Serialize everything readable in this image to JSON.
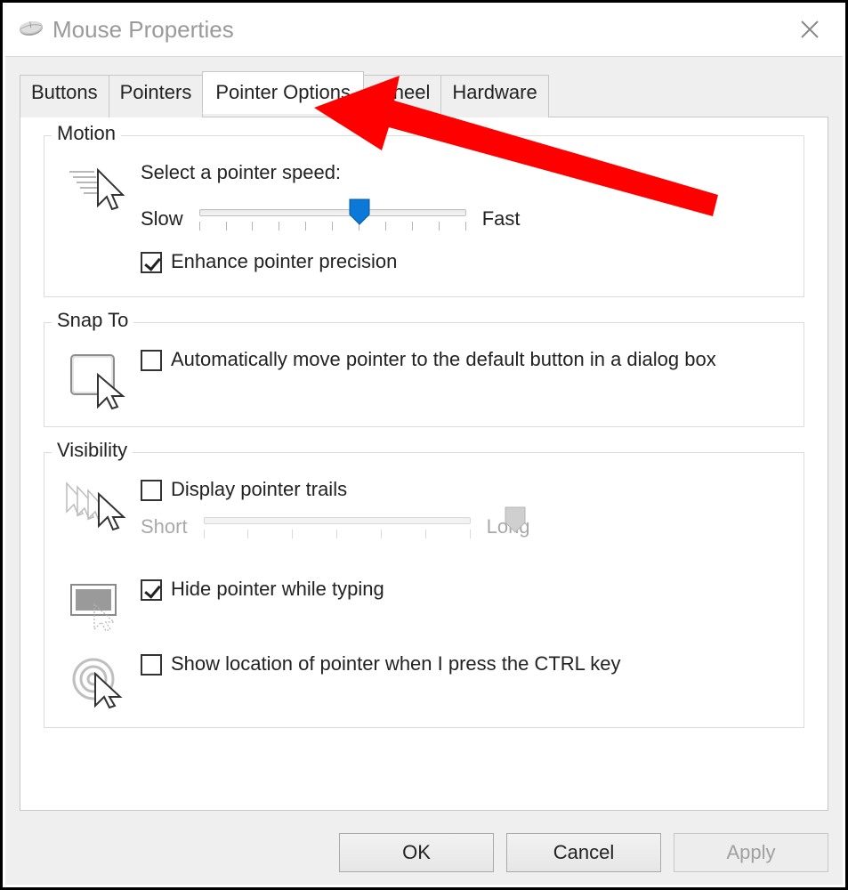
{
  "window": {
    "title": "Mouse Properties"
  },
  "tabs": {
    "buttons": "Buttons",
    "pointers": "Pointers",
    "pointer_options": "Pointer Options",
    "wheel": "Wheel",
    "hardware": "Hardware",
    "active": "pointer_options"
  },
  "motion": {
    "legend": "Motion",
    "heading": "Select a pointer speed:",
    "slider_min_label": "Slow",
    "slider_max_label": "Fast",
    "slider_value": 6,
    "slider_ticks": 11,
    "enhance_precision": {
      "label": "Enhance pointer precision",
      "checked": true
    }
  },
  "snap_to": {
    "legend": "Snap To",
    "auto_move": {
      "label": "Automatically move pointer to the default button in a dialog box",
      "checked": false
    }
  },
  "visibility": {
    "legend": "Visibility",
    "trails": {
      "label": "Display pointer trails",
      "checked": false
    },
    "trails_slider": {
      "min_label": "Short",
      "max_label": "Long",
      "value": 7,
      "ticks": 7,
      "enabled": false
    },
    "hide_typing": {
      "label": "Hide pointer while typing",
      "checked": true
    },
    "show_ctrl": {
      "label": "Show location of pointer when I press the CTRL key",
      "checked": false
    }
  },
  "buttons_row": {
    "ok": "OK",
    "cancel": "Cancel",
    "apply": "Apply"
  },
  "annotation": {
    "type": "arrow",
    "color": "#ff0000",
    "points_to": "Pointer Options tab"
  }
}
